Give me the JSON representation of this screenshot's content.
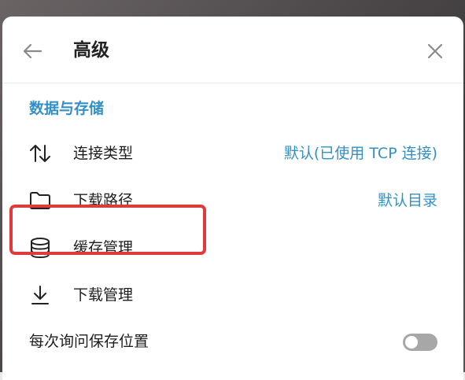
{
  "header": {
    "title": "高级",
    "back_icon": "arrow-left-icon",
    "close_icon": "close-icon"
  },
  "section": {
    "title": "数据与存储"
  },
  "rows": [
    {
      "label": "连接类型",
      "value": "默认(已使用 TCP 连接)",
      "icon": "swap-vertical-icon"
    },
    {
      "label": "下载路径",
      "value": "默认目录",
      "icon": "folder-icon"
    },
    {
      "label": "缓存管理",
      "value": "",
      "icon": "database-icon"
    },
    {
      "label": "下载管理",
      "value": "",
      "icon": "download-icon"
    }
  ],
  "toggle_row": {
    "label": "每次询问保存位置",
    "enabled": false
  },
  "colors": {
    "accent": "#3390c6",
    "highlight_border": "#e03b3b",
    "toggle_off": "#a7a7a7",
    "text": "#1e1e1e"
  }
}
